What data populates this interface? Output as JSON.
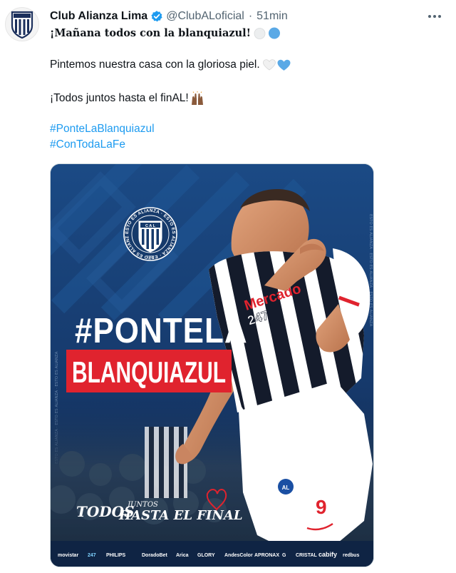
{
  "author": {
    "name": "Club Alianza Lima",
    "handle": "@ClubALoficial",
    "time": "51min",
    "separator": "·"
  },
  "tweet": {
    "line1": "¡Mañana todos con la blanquiazul!",
    "line2": "Pintemos nuestra casa con la gloriosa piel.",
    "line3": "¡Todos juntos hasta el finAL!",
    "hashtags": [
      "#PonteLaBlanquiazul",
      "#ConTodaLaFe"
    ]
  },
  "media": {
    "headline_top": "#PONTELA",
    "headline_bottom": "BLANQUIAZUL",
    "tagline_1": "TODOS",
    "tagline_2": "JUNTOS",
    "tagline_3": "HASTA EL FINAL",
    "crest_ring_text": "ESTO ES ALIANZA · ESTO ES ALIANZA · ESTO ES ALIANZA ·",
    "crest_letters": "C A L",
    "crest_year": "1901",
    "shirt_sponsor": "Mercado",
    "shirt_sponsor_2": "247",
    "shirt_number": "9",
    "sponsors": [
      "movistar",
      "247",
      "PHILIPS",
      "DoradoBet",
      "Arica",
      "GLORY",
      "AndesColor",
      "APRONAX",
      "G",
      "CRISTAL",
      "cabify",
      "redbus"
    ]
  },
  "colors": {
    "accent": "#1d9bf0",
    "brand_navy": "#163a6b",
    "brand_red": "#e0232e",
    "verified": "#1d9bf0"
  },
  "icons": [
    "verified-badge-icon",
    "more-options-icon",
    "white-heart-emoji",
    "blue-heart-emoji",
    "raised-hands-emoji",
    "club-crest-icon"
  ]
}
